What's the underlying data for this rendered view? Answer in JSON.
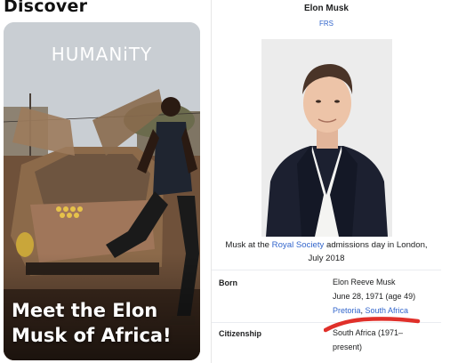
{
  "discover": {
    "heading": "Discover",
    "card": {
      "brand": "HUMANiTY",
      "headline": "Meet the Elon Musk of Africa!"
    }
  },
  "infobox": {
    "title": "Elon Musk",
    "subtitle": "FRS",
    "caption": {
      "before": "Musk at the ",
      "link": "Royal Society",
      "after": " admissions day in London, July 2018"
    },
    "born": {
      "label": "Born",
      "name": "Elon Reeve Musk",
      "date": "June 28, 1971 (age 49)",
      "place_city": "Pretoria",
      "place_sep": ", ",
      "place_country": "South Africa"
    },
    "citizenship": {
      "label": "Citizenship",
      "value_line1": "South Africa (1971–",
      "value_line2": "present)"
    }
  },
  "colors": {
    "link": "#3366cc",
    "annotation": "#e0302a",
    "text": "#202122"
  }
}
